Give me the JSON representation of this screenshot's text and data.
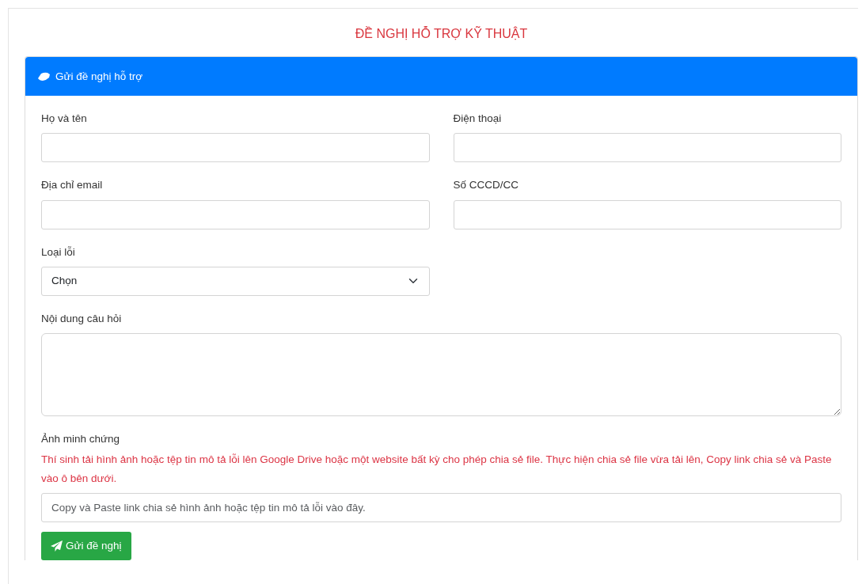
{
  "title": "ĐỀ NGHỊ HỖ TRỢ KỸ THUẬT",
  "panel": {
    "header": "Gửi đề nghị hỗ trợ"
  },
  "rows": [
    [
      {
        "kind": "text",
        "label": "Họ và tên"
      },
      {
        "kind": "text",
        "label": "Điện thoại"
      }
    ],
    [
      {
        "kind": "text",
        "label": "Địa chỉ email"
      },
      {
        "kind": "text",
        "label": "Số CCCD/CC"
      }
    ],
    [
      {
        "kind": "select",
        "label": "Loại lỗi",
        "value": "Chọn"
      }
    ],
    [
      {
        "kind": "textarea",
        "label": "Nội dung câu hỏi"
      }
    ],
    [
      {
        "kind": "text",
        "label": "Ảnh minh chứng",
        "note": "Thí sinh tải hình ảnh hoặc tệp tin mô tả lỗi lên Google Drive hoặc một website bất kỳ cho phép chia sẻ file. Thực hiện chia sẻ file vừa tải lên, Copy link chia sẻ và Paste vào ô bên dưới.",
        "placeholder": "Copy và Paste link chia sẻ hình ảnh hoặc tệp tin mô tả lỗi vào đây."
      }
    ]
  ],
  "submit": {
    "label": "Gửi đề nghị"
  }
}
